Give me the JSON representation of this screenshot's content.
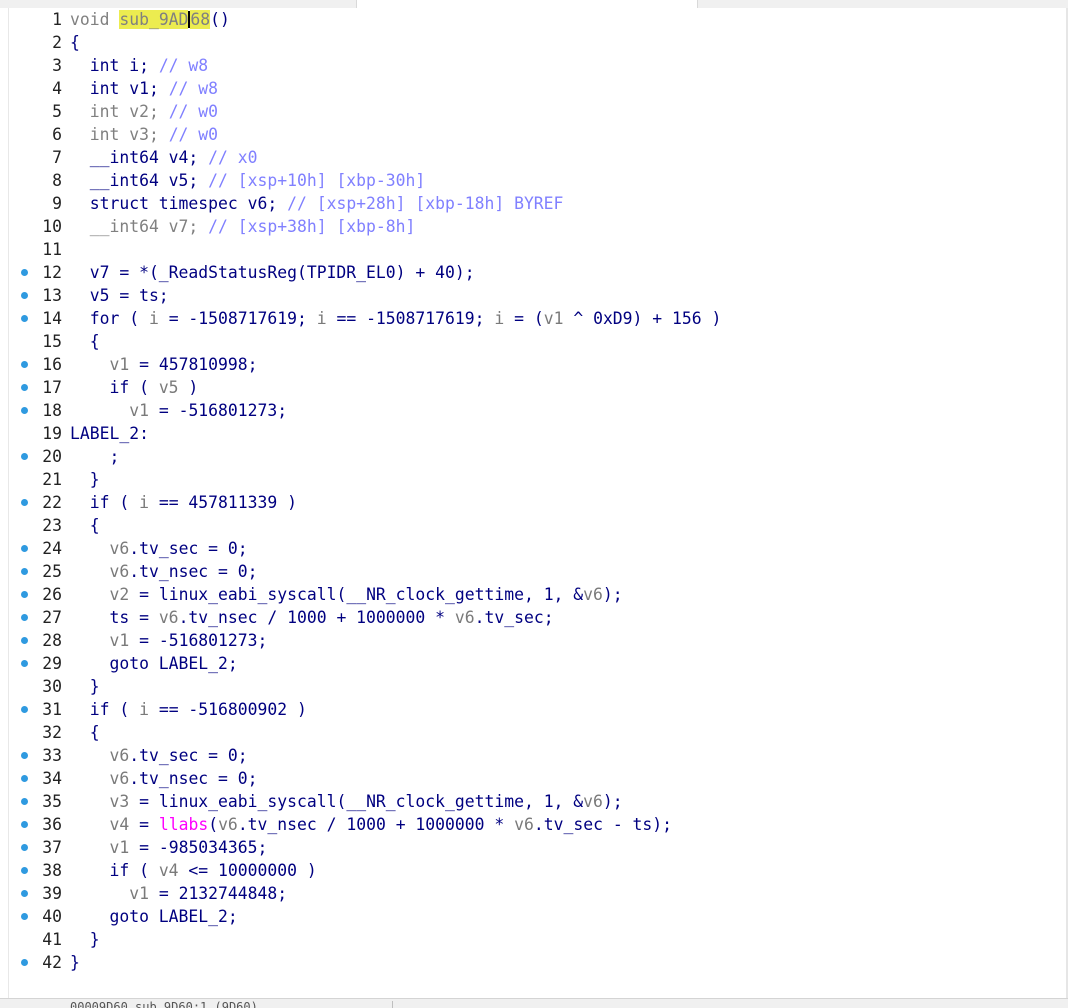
{
  "status_bar": {
    "text": "00009D60 sub_9D60:1 (9D60)"
  },
  "lines": [
    {
      "n": 1,
      "marker": false,
      "tokens": [
        [
          "void ",
          "type"
        ],
        [
          "sub_9AD",
          "fname"
        ],
        [
          "|",
          "caret"
        ],
        [
          "68",
          "fname-tail"
        ],
        [
          "()",
          "op"
        ]
      ]
    },
    {
      "n": 2,
      "marker": false,
      "tokens": [
        [
          "{",
          "op"
        ]
      ]
    },
    {
      "n": 3,
      "marker": false,
      "tokens": [
        [
          "  int i; ",
          "kw"
        ],
        [
          "// w8",
          "cmt"
        ]
      ]
    },
    {
      "n": 4,
      "marker": false,
      "tokens": [
        [
          "  int v1; ",
          "kw"
        ],
        [
          "// w8",
          "cmt"
        ]
      ]
    },
    {
      "n": 5,
      "marker": false,
      "tokens": [
        [
          "  int v2; ",
          "type"
        ],
        [
          "// w0",
          "cmt"
        ]
      ]
    },
    {
      "n": 6,
      "marker": false,
      "tokens": [
        [
          "  int v3; ",
          "type"
        ],
        [
          "// w0",
          "cmt"
        ]
      ]
    },
    {
      "n": 7,
      "marker": false,
      "tokens": [
        [
          "  __int64 v4; ",
          "kw"
        ],
        [
          "// x0",
          "cmt"
        ]
      ]
    },
    {
      "n": 8,
      "marker": false,
      "tokens": [
        [
          "  __int64 v5; ",
          "kw"
        ],
        [
          "// [xsp+10h] [xbp-30h]",
          "cmt"
        ]
      ]
    },
    {
      "n": 9,
      "marker": false,
      "tokens": [
        [
          "  struct timespec v6; ",
          "kw"
        ],
        [
          "// [xsp+28h] [xbp-18h] BYREF",
          "cmt"
        ]
      ]
    },
    {
      "n": 10,
      "marker": false,
      "tokens": [
        [
          "  __int64 v7; ",
          "type"
        ],
        [
          "// [xsp+38h] [xbp-8h]",
          "cmt"
        ]
      ]
    },
    {
      "n": 11,
      "marker": false,
      "tokens": []
    },
    {
      "n": 12,
      "marker": true,
      "tokens": [
        [
          "  v7 = *(_ReadStatusReg(TPIDR_EL0) + 40);",
          "kw"
        ]
      ]
    },
    {
      "n": 13,
      "marker": true,
      "tokens": [
        [
          "  v5 = ts;",
          "kw"
        ]
      ]
    },
    {
      "n": 14,
      "marker": true,
      "tokens": [
        [
          "  for ( ",
          "kw"
        ],
        [
          "i",
          "var"
        ],
        [
          " = -1508717619; ",
          "kw"
        ],
        [
          "i",
          "var"
        ],
        [
          " == -1508717619; ",
          "kw"
        ],
        [
          "i",
          "var"
        ],
        [
          " = (",
          "kw"
        ],
        [
          "v1",
          "var"
        ],
        [
          " ^ 0xD9) + 156 )",
          "kw"
        ]
      ]
    },
    {
      "n": 15,
      "marker": false,
      "tokens": [
        [
          "  {",
          "op"
        ]
      ]
    },
    {
      "n": 16,
      "marker": true,
      "tokens": [
        [
          "    ",
          "op"
        ],
        [
          "v1",
          "var"
        ],
        [
          " = 457810998;",
          "kw"
        ]
      ]
    },
    {
      "n": 17,
      "marker": true,
      "tokens": [
        [
          "    if ( ",
          "kw"
        ],
        [
          "v5",
          "var"
        ],
        [
          " )",
          "kw"
        ]
      ]
    },
    {
      "n": 18,
      "marker": true,
      "tokens": [
        [
          "      ",
          "op"
        ],
        [
          "v1",
          "var"
        ],
        [
          " = -516801273;",
          "kw"
        ]
      ]
    },
    {
      "n": 19,
      "marker": false,
      "tokens": [
        [
          "LABEL_2:",
          "kw"
        ]
      ]
    },
    {
      "n": 20,
      "marker": true,
      "tokens": [
        [
          "    ;",
          "kw"
        ]
      ]
    },
    {
      "n": 21,
      "marker": false,
      "tokens": [
        [
          "  }",
          "op"
        ]
      ]
    },
    {
      "n": 22,
      "marker": true,
      "tokens": [
        [
          "  if ( ",
          "kw"
        ],
        [
          "i",
          "var"
        ],
        [
          " == 457811339 )",
          "kw"
        ]
      ]
    },
    {
      "n": 23,
      "marker": false,
      "tokens": [
        [
          "  {",
          "op"
        ]
      ]
    },
    {
      "n": 24,
      "marker": true,
      "tokens": [
        [
          "    ",
          "op"
        ],
        [
          "v6",
          "var"
        ],
        [
          ".tv_sec = 0;",
          "kw"
        ]
      ]
    },
    {
      "n": 25,
      "marker": true,
      "tokens": [
        [
          "    ",
          "op"
        ],
        [
          "v6",
          "var"
        ],
        [
          ".tv_nsec = 0;",
          "kw"
        ]
      ]
    },
    {
      "n": 26,
      "marker": true,
      "tokens": [
        [
          "    ",
          "op"
        ],
        [
          "v2",
          "var"
        ],
        [
          " = linux_eabi_syscall(__NR_clock_gettime, 1, &",
          "kw"
        ],
        [
          "v6",
          "var"
        ],
        [
          ");",
          "kw"
        ]
      ]
    },
    {
      "n": 27,
      "marker": true,
      "tokens": [
        [
          "    ts = ",
          "kw"
        ],
        [
          "v6",
          "var"
        ],
        [
          ".tv_nsec / 1000 + 1000000 * ",
          "kw"
        ],
        [
          "v6",
          "var"
        ],
        [
          ".tv_sec;",
          "kw"
        ]
      ]
    },
    {
      "n": 28,
      "marker": true,
      "tokens": [
        [
          "    ",
          "op"
        ],
        [
          "v1",
          "var"
        ],
        [
          " = -516801273;",
          "kw"
        ]
      ]
    },
    {
      "n": 29,
      "marker": true,
      "tokens": [
        [
          "    goto LABEL_2;",
          "kw"
        ]
      ]
    },
    {
      "n": 30,
      "marker": false,
      "tokens": [
        [
          "  }",
          "op"
        ]
      ]
    },
    {
      "n": 31,
      "marker": true,
      "tokens": [
        [
          "  if ( ",
          "kw"
        ],
        [
          "i",
          "var"
        ],
        [
          " == -516800902 )",
          "kw"
        ]
      ]
    },
    {
      "n": 32,
      "marker": false,
      "tokens": [
        [
          "  {",
          "op"
        ]
      ]
    },
    {
      "n": 33,
      "marker": true,
      "tokens": [
        [
          "    ",
          "op"
        ],
        [
          "v6",
          "var"
        ],
        [
          ".tv_sec = 0;",
          "kw"
        ]
      ]
    },
    {
      "n": 34,
      "marker": true,
      "tokens": [
        [
          "    ",
          "op"
        ],
        [
          "v6",
          "var"
        ],
        [
          ".tv_nsec = 0;",
          "kw"
        ]
      ]
    },
    {
      "n": 35,
      "marker": true,
      "tokens": [
        [
          "    ",
          "op"
        ],
        [
          "v3",
          "var"
        ],
        [
          " = linux_eabi_syscall(__NR_clock_gettime, 1, &",
          "kw"
        ],
        [
          "v6",
          "var"
        ],
        [
          ");",
          "kw"
        ]
      ]
    },
    {
      "n": 36,
      "marker": true,
      "tokens": [
        [
          "    ",
          "op"
        ],
        [
          "v4",
          "var"
        ],
        [
          " = ",
          "kw"
        ],
        [
          "llabs",
          "lib"
        ],
        [
          "(",
          "kw"
        ],
        [
          "v6",
          "var"
        ],
        [
          ".tv_nsec / 1000 + 1000000 * ",
          "kw"
        ],
        [
          "v6",
          "var"
        ],
        [
          ".tv_sec - ts);",
          "kw"
        ]
      ]
    },
    {
      "n": 37,
      "marker": true,
      "tokens": [
        [
          "    ",
          "op"
        ],
        [
          "v1",
          "var"
        ],
        [
          " = -985034365;",
          "kw"
        ]
      ]
    },
    {
      "n": 38,
      "marker": true,
      "tokens": [
        [
          "    if ( ",
          "kw"
        ],
        [
          "v4",
          "var"
        ],
        [
          " <= 10000000 )",
          "kw"
        ]
      ]
    },
    {
      "n": 39,
      "marker": true,
      "tokens": [
        [
          "      ",
          "op"
        ],
        [
          "v1",
          "var"
        ],
        [
          " = 2132744848;",
          "kw"
        ]
      ]
    },
    {
      "n": 40,
      "marker": true,
      "tokens": [
        [
          "    goto LABEL_2;",
          "kw"
        ]
      ]
    },
    {
      "n": 41,
      "marker": false,
      "tokens": [
        [
          "  }",
          "op"
        ]
      ]
    },
    {
      "n": 42,
      "marker": true,
      "tokens": [
        [
          "}",
          "op"
        ]
      ]
    }
  ]
}
